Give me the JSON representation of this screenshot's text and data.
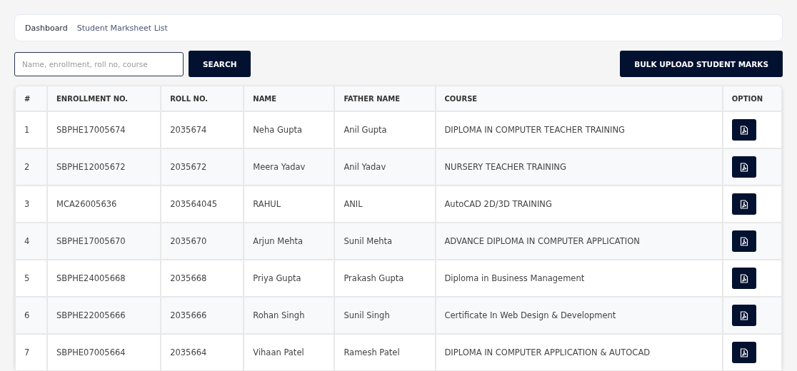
{
  "breadcrumb": [
    {
      "label": "Dashboard",
      "current": false
    },
    {
      "label": "Student Marksheet List",
      "current": true
    }
  ],
  "search": {
    "placeholder": "Name, enrollment, roll no, course",
    "button": "SEARCH"
  },
  "bulk_upload_button": "BULK UPLOAD STUDENT MARKS",
  "table": {
    "columns": [
      "#",
      "ENROLLMENT NO.",
      "ROLL NO.",
      "NAME",
      "FATHER NAME",
      "COURSE",
      "OPTION"
    ],
    "rows": [
      {
        "index": "1",
        "enrollment": "SBPHE17005674",
        "roll": "2035674",
        "name": "Neha Gupta",
        "father": "Anil Gupta",
        "course": "DIPLOMA IN COMPUTER TEACHER TRAINING"
      },
      {
        "index": "2",
        "enrollment": "SBPHE12005672",
        "roll": "2035672",
        "name": "Meera Yadav",
        "father": "Anil Yadav",
        "course": "NURSERY TEACHER TRAINING"
      },
      {
        "index": "3",
        "enrollment": "MCA26005636",
        "roll": "203564045",
        "name": "RAHUL",
        "father": "ANIL",
        "course": "AutoCAD 2D/3D TRAINING"
      },
      {
        "index": "4",
        "enrollment": "SBPHE17005670",
        "roll": "2035670",
        "name": "Arjun Mehta",
        "father": "Sunil Mehta",
        "course": "ADVANCE DIPLOMA IN COMPUTER APPLICATION"
      },
      {
        "index": "5",
        "enrollment": "SBPHE24005668",
        "roll": "2035668",
        "name": "Priya Gupta",
        "father": "Prakash Gupta",
        "course": "Diploma in Business Management"
      },
      {
        "index": "6",
        "enrollment": "SBPHE22005666",
        "roll": "2035666",
        "name": "Rohan Singh",
        "father": "Sunil Singh",
        "course": "Certificate In Web Design & Development"
      },
      {
        "index": "7",
        "enrollment": "SBPHE07005664",
        "roll": "2035664",
        "name": "Vihaan Patel",
        "father": "Ramesh Patel",
        "course": "DIPLOMA IN COMPUTER APPLICATION & AUTOCAD"
      }
    ]
  }
}
